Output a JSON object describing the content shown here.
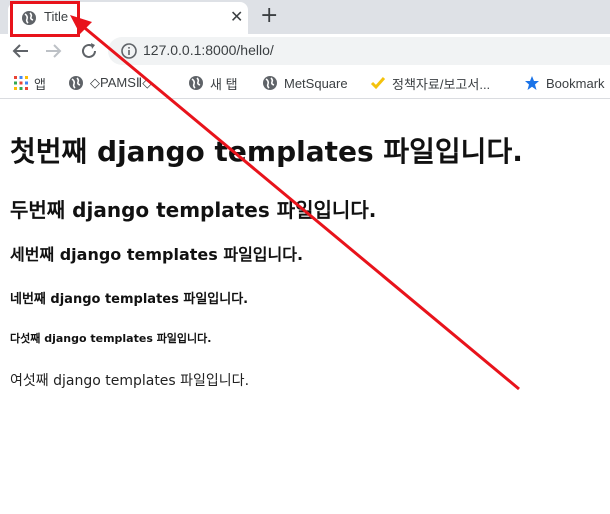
{
  "tab": {
    "title": "Title",
    "close_glyph": "✕",
    "new_tab_glyph": "+"
  },
  "toolbar": {
    "url": "127.0.0.1:8000/hello/"
  },
  "bookmarks": [
    {
      "label": "앱",
      "icon": "apps-grid-icon"
    },
    {
      "label": "◇PAMSⅡ◇",
      "icon": "globe-icon"
    },
    {
      "label": "새 탭",
      "icon": "globe-icon"
    },
    {
      "label": "MetSquare",
      "icon": "globe-icon"
    },
    {
      "label": "정책자료/보고서...",
      "icon": "checkmark-icon"
    },
    {
      "label": "Bookmark",
      "icon": "star-icon"
    }
  ],
  "page": {
    "h1": "첫번째 django templates 파일입니다.",
    "h2": "두번째 django templates 파일입니다.",
    "h3": "세번째 django templates 파일입니다.",
    "h4": "네번째 django templates 파일입니다.",
    "h5": "다섯째 django templates 파일입니다.",
    "p": "여섯째 django templates 파일입니다."
  },
  "colors": {
    "annotation_red": "#e8131b",
    "tab_strip": "#dee1e6",
    "star_blue": "#1a73e8",
    "check_yellow": "#f4c20d"
  }
}
